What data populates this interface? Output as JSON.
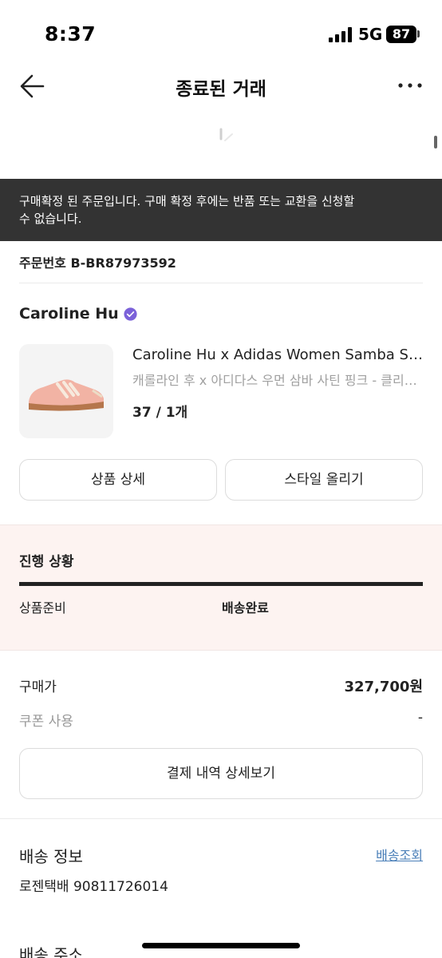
{
  "status_bar": {
    "time": "8:37",
    "network": "5G",
    "battery": "87"
  },
  "header": {
    "title": "종료된 거래",
    "back_icon": "arrow-left-icon",
    "more_icon": "more-dots-icon"
  },
  "notice": {
    "text_line1": "구매확정 된 주문입니다. 구매 확정 후에는 반품 또는 교환을 신청할",
    "text_line2": "수 없습니다."
  },
  "order": {
    "label": "주문번호",
    "number": "B-BR87973592"
  },
  "brand": {
    "name": "Caroline Hu",
    "verified_icon": "verified-badge-icon",
    "verified_color": "#7b61d9"
  },
  "product": {
    "title": "Caroline Hu x Adidas Women Samba Satin Pink",
    "subtitle": "캐롤라인 후 x 아디다스 우먼 삼바 사틴 핑크 - 클리어 핑크",
    "option": "37 / 1개",
    "image_icon": "sneaker-image"
  },
  "actions": {
    "product_detail": "상품 상세",
    "post_style": "스타일 올리기"
  },
  "progress": {
    "title": "진행 상황",
    "steps": [
      "상품준비",
      "배송완료"
    ],
    "current_step": 2,
    "fill_fraction": 1.0,
    "bg_color": "#fdf3f1"
  },
  "payment": {
    "price_label": "구매가",
    "price_value": "327,700원",
    "coupon_label": "쿠폰 사용",
    "coupon_value": "-",
    "detail_button": "결제 내역 상세보기"
  },
  "shipping": {
    "title": "배송 정보",
    "track_link": "배송조회",
    "carrier_info": "로젠택배 90811726014",
    "link_color": "#4a7fb8"
  },
  "address": {
    "title": "배송 주소"
  }
}
